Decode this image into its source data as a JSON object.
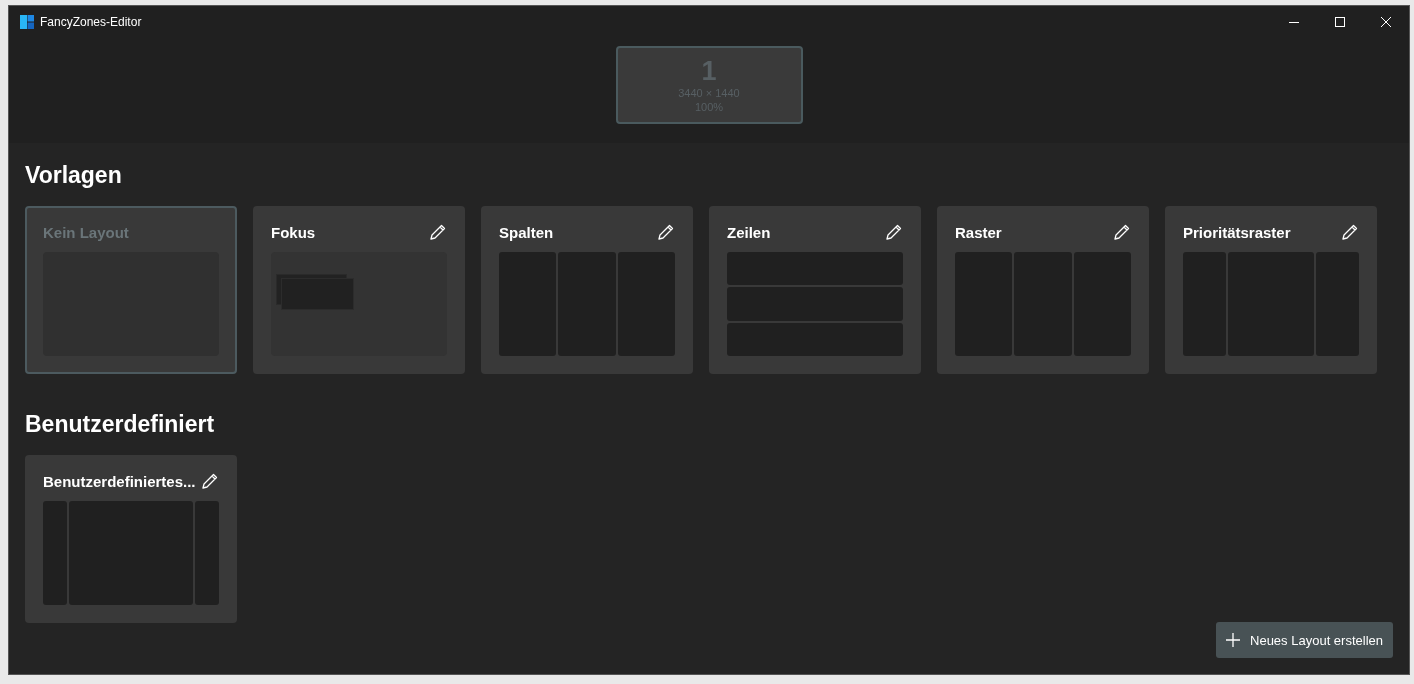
{
  "window": {
    "title": "FancyZones-Editor"
  },
  "monitors": [
    {
      "number": "1",
      "resolution": "3440 × 1440",
      "scaling": "100%",
      "selected": true
    }
  ],
  "sections": [
    {
      "heading": "Vorlagen",
      "layouts": [
        {
          "name": "Kein Layout",
          "kind": "blank",
          "selected": true,
          "editable": false
        },
        {
          "name": "Fokus",
          "kind": "focus",
          "selected": false,
          "editable": true
        },
        {
          "name": "Spalten",
          "kind": "columns",
          "selected": false,
          "editable": true
        },
        {
          "name": "Zeilen",
          "kind": "rows",
          "selected": false,
          "editable": true
        },
        {
          "name": "Raster",
          "kind": "grid",
          "selected": false,
          "editable": true
        },
        {
          "name": "Prioritätsraster",
          "kind": "priority-grid",
          "selected": false,
          "editable": true
        }
      ]
    },
    {
      "heading": "Benutzerdefiniert",
      "layouts": [
        {
          "name": "Benutzerdefiniertes...",
          "kind": "custom-columns",
          "selected": false,
          "editable": true
        }
      ]
    }
  ],
  "create_button": {
    "label": "Neues Layout erstellen"
  }
}
